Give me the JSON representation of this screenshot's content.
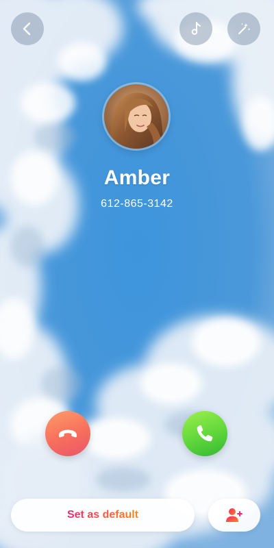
{
  "contact": {
    "name": "Amber",
    "phone": "612-865-3142"
  },
  "toolbar": {
    "back_icon": "chevron-left-icon",
    "music_icon": "music-note-icon",
    "magic_icon": "magic-wand-icon"
  },
  "call_actions": {
    "decline_icon": "phone-hangup-icon",
    "accept_icon": "phone-icon",
    "decline_color": "#f76e5c",
    "accept_color": "#5fd63a"
  },
  "footer": {
    "set_default_label": "Set as default",
    "add_contact_icon": "add-person-icon",
    "accent_gradient": [
      "#f0286e",
      "#ff5a3c",
      "#ff8a1c"
    ]
  }
}
